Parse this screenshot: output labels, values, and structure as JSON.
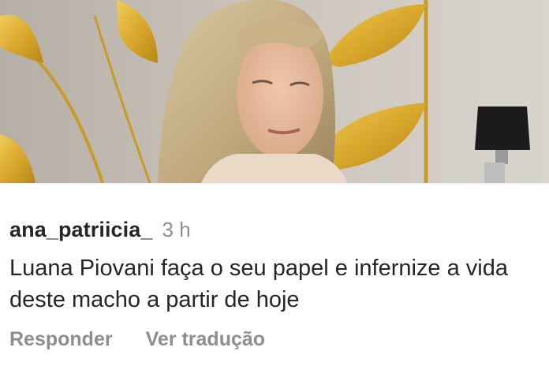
{
  "comment": {
    "username": "ana_patriicia_",
    "timestamp": "3 h",
    "text": "Luana Piovani faça o seu papel e infernize a vida deste macho a partir de hoje"
  },
  "actions": {
    "reply_label": "Responder",
    "translate_label": "Ver tradução"
  },
  "colors": {
    "username": "#262626",
    "text": "#262626",
    "secondary": "#8e8e8e",
    "background": "#ffffff",
    "leaf_gold": "#d9a82c"
  }
}
